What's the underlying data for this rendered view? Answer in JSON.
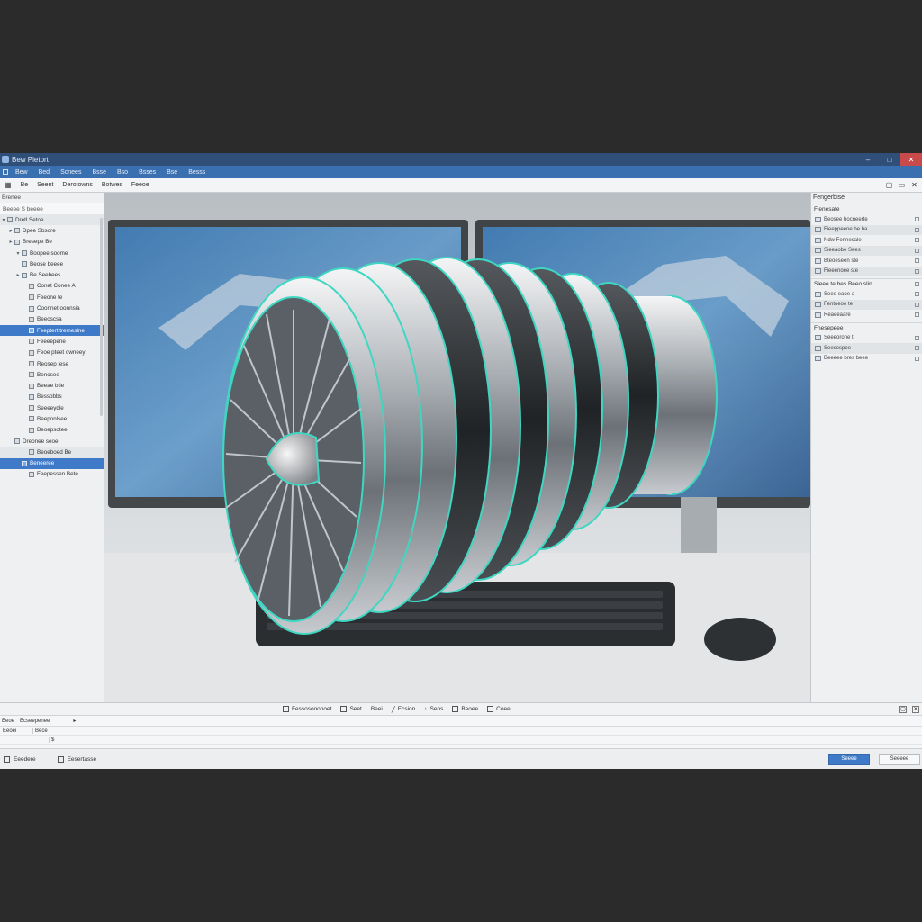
{
  "window": {
    "title": "Bew Pletort"
  },
  "menubar": {
    "items": [
      "Bew",
      "Bed",
      "Scnees",
      "Bsse",
      "Bso",
      "Bsses",
      "Bse",
      "Besss"
    ]
  },
  "toolbar": {
    "items": [
      "Be",
      "Seent",
      "Derotowns",
      "Botwes",
      "Feeoe"
    ]
  },
  "left_panel": {
    "title": "Brenee",
    "subtitle": "Beeee S beeee",
    "header_row": "Dretl Setoe",
    "tree": [
      {
        "label": "Dpee Sbsore",
        "indent": 1,
        "chev": "▸",
        "state": ""
      },
      {
        "label": "Bresepe Be",
        "indent": 1,
        "chev": "▸",
        "state": ""
      },
      {
        "label": "Boopee soome",
        "indent": 2,
        "chev": "▾",
        "state": ""
      },
      {
        "label": "Beose beeee",
        "indent": 2,
        "chev": "",
        "state": ""
      },
      {
        "label": "Be Seebees",
        "indent": 2,
        "chev": "▸",
        "state": ""
      },
      {
        "label": "Conet Conee A",
        "indent": 3,
        "chev": "",
        "state": ""
      },
      {
        "label": "Feeone te",
        "indent": 3,
        "chev": "",
        "state": ""
      },
      {
        "label": "Coonnet oonnsia",
        "indent": 3,
        "chev": "",
        "state": ""
      },
      {
        "label": "Beeoscsa",
        "indent": 3,
        "chev": "",
        "state": ""
      },
      {
        "label": "Feeptert tremeslne",
        "indent": 3,
        "chev": "",
        "state": "sel"
      },
      {
        "label": "Feeeepene",
        "indent": 3,
        "chev": "",
        "state": ""
      },
      {
        "label": "Feoe pteet owneey",
        "indent": 3,
        "chev": "",
        "state": ""
      },
      {
        "label": "Reosep lese",
        "indent": 3,
        "chev": "",
        "state": ""
      },
      {
        "label": "Benosee",
        "indent": 3,
        "chev": "",
        "state": ""
      },
      {
        "label": "Beeae btle",
        "indent": 3,
        "chev": "",
        "state": ""
      },
      {
        "label": "Bessobbs",
        "indent": 3,
        "chev": "",
        "state": ""
      },
      {
        "label": "Seeeeydle",
        "indent": 3,
        "chev": "",
        "state": ""
      },
      {
        "label": "Beeponlsee",
        "indent": 3,
        "chev": "",
        "state": ""
      },
      {
        "label": "Beoepsotee",
        "indent": 3,
        "chev": "",
        "state": ""
      },
      {
        "label": "Dreonee seoe",
        "indent": 1,
        "chev": "",
        "state": ""
      },
      {
        "label": "Beoeboed Be",
        "indent": 3,
        "chev": "",
        "state": "alt"
      },
      {
        "label": "Beneeree",
        "indent": 2,
        "chev": "",
        "state": "sel"
      },
      {
        "label": "Feepessen Bete",
        "indent": 3,
        "chev": "",
        "state": ""
      }
    ]
  },
  "right_panel": {
    "title": "Fengerbise",
    "section1_title": "Fienesate",
    "rows1": [
      "Beosee bocneerte",
      "Fieeppeene be ba",
      "Ndw Fennesale",
      "Sieeaobe Sees",
      "Bteoeseen ste",
      "Fieeenoee ste"
    ],
    "section2_title": "Sieee te bes Beeo slin",
    "rows2": [
      "Seee eaoe a",
      "Fentoeoe te",
      "Reaeeaare"
    ],
    "section3_title": "Fnesepeee",
    "rows3": [
      "Seeeorone t",
      "Seesespee",
      "Beeeee bres beee"
    ]
  },
  "bottom_toolbar": {
    "tools": [
      "Fessosooonoet",
      "Seet",
      "Beei",
      "Ecsion",
      "Seos",
      "Beoee",
      "Coee"
    ]
  },
  "output": {
    "tabs": [
      "Eeoe",
      "Ecseepenee"
    ],
    "fields": [
      {
        "c1": "Eeoei",
        "c2": "Bece",
        "c3": ""
      },
      {
        "c1": "",
        "c2": "",
        "c3": "$"
      }
    ]
  },
  "status": {
    "items": [
      "Eeedere",
      "Eesertasse"
    ],
    "primary_button": "Seeee",
    "secondary_button": "Seeeee"
  },
  "colors": {
    "accent": "#3a6fb0",
    "selection": "#3f7ac9",
    "edge_glow": "#3fd6c2"
  }
}
